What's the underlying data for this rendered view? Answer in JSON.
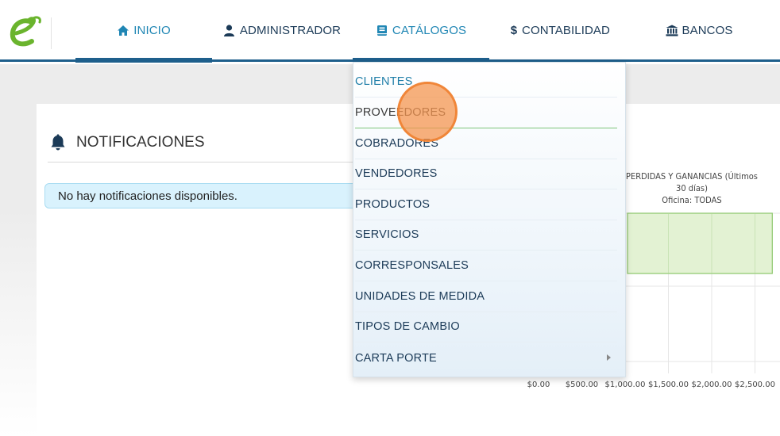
{
  "nav": {
    "items": [
      {
        "label": "INICIO",
        "icon": "home-icon"
      },
      {
        "label": "ADMINISTRADOR",
        "icon": "user-icon"
      },
      {
        "label": "CATÁLOGOS",
        "icon": "book-icon"
      },
      {
        "label": "CONTABILIDAD",
        "icon": "dollar-icon"
      },
      {
        "label": "BANCOS",
        "icon": "bank-icon"
      }
    ]
  },
  "dropdown": {
    "items": [
      {
        "label": "CLIENTES"
      },
      {
        "label": "PROVEEDORES"
      },
      {
        "label": "COBRADORES"
      },
      {
        "label": "VENDEDORES"
      },
      {
        "label": "PRODUCTOS"
      },
      {
        "label": "SERVICIOS"
      },
      {
        "label": "CORRESPONSALES"
      },
      {
        "label": "UNIDADES DE MEDIDA"
      },
      {
        "label": "TIPOS DE CAMBIO"
      },
      {
        "label": "CARTA PORTE"
      }
    ]
  },
  "notifications": {
    "title": "NOTIFICACIONES",
    "empty_message": "No hay notificaciones disponibles."
  },
  "chart": {
    "title_line1": "PERDIDAS Y GANANCIAS (Últimos 30 días)",
    "title_line2": "Oficina: TODAS"
  },
  "chart_data": {
    "type": "bar",
    "orientation": "horizontal",
    "title": "PERDIDAS Y GANANCIAS (Últimos 30 días)",
    "subtitle": "Oficina: TODAS",
    "x_ticks": [
      "$0.00",
      "$500.00",
      "$1,000.00",
      "$1,500.00",
      "$2,000.00",
      "$2,500.00"
    ],
    "xlim": [
      0,
      2500
    ],
    "values": [
      2700
    ],
    "bar_color": "#e3f2d3",
    "bar_border": "#8cc66b",
    "grid": true
  },
  "colors": {
    "nav_active": "#1f86b4",
    "nav_text": "#1b3a57",
    "nav_bar": "#1e5f8c",
    "alert_bg": "#d9f2fd",
    "logo_green": "#6ab42d"
  }
}
